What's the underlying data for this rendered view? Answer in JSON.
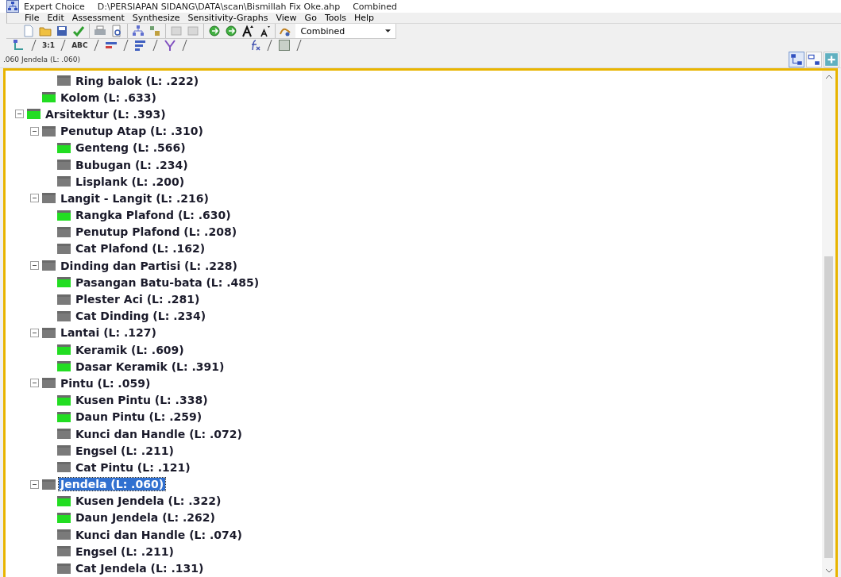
{
  "window": {
    "title": "Expert Choice",
    "file": "D:\\PERSIAPAN SIDANG\\DATA\\scan\\Bismillah Fix Oke.ahp",
    "mode": "Combined"
  },
  "menu": [
    "File",
    "Edit",
    "Assessment",
    "Synthesize",
    "Sensitivity-Graphs",
    "View",
    "Go",
    "Tools",
    "Help"
  ],
  "toolbar": {
    "combo": "Combined"
  },
  "view_tabs": [
    {
      "label": "3:1"
    },
    {
      "label": "ABC"
    }
  ],
  "status": ".060  Jendela (L: .060)",
  "tree": [
    {
      "children": [
        {
          "children": [
            {
              "label": "Ring balok (L: .222)",
              "color": "#7a7a7a",
              "selected": false
            }
          ]
        },
        {
          "label": "Kolom (L: .633)",
          "color": "#22dd22",
          "selected": false
        }
      ]
    },
    {
      "label": "Arsitektur (L: .393)",
      "color": "#22dd22",
      "selected": false,
      "expanded": true,
      "children": [
        {
          "label": "Penutup Atap (L: .310)",
          "color": "#7a7a7a",
          "selected": false,
          "expanded": true,
          "children": [
            {
              "label": "Genteng (L: .566)",
              "color": "#22dd22",
              "selected": false
            },
            {
              "label": "Bubugan (L: .234)",
              "color": "#7a7a7a",
              "selected": false
            },
            {
              "label": "Lisplank (L: .200)",
              "color": "#7a7a7a",
              "selected": false
            }
          ]
        },
        {
          "label": "Langit - Langit (L: .216)",
          "color": "#7a7a7a",
          "selected": false,
          "expanded": true,
          "children": [
            {
              "label": "Rangka Plafond (L: .630)",
              "color": "#22dd22",
              "selected": false
            },
            {
              "label": "Penutup Plafond (L: .208)",
              "color": "#7a7a7a",
              "selected": false
            },
            {
              "label": "Cat Plafond (L: .162)",
              "color": "#7a7a7a",
              "selected": false
            }
          ]
        },
        {
          "label": "Dinding dan Partisi (L: .228)",
          "color": "#7a7a7a",
          "selected": false,
          "expanded": true,
          "children": [
            {
              "label": "Pasangan Batu-bata (L: .485)",
              "color": "#22dd22",
              "selected": false
            },
            {
              "label": "Plester Aci (L: .281)",
              "color": "#7a7a7a",
              "selected": false
            },
            {
              "label": "Cat Dinding (L: .234)",
              "color": "#7a7a7a",
              "selected": false
            }
          ]
        },
        {
          "label": "Lantai (L: .127)",
          "color": "#7a7a7a",
          "selected": false,
          "expanded": true,
          "children": [
            {
              "label": "Keramik (L: .609)",
              "color": "#22dd22",
              "selected": false
            },
            {
              "label": "Dasar Keramik (L: .391)",
              "color": "#22dd22",
              "selected": false
            }
          ]
        },
        {
          "label": "Pintu (L: .059)",
          "color": "#7a7a7a",
          "selected": false,
          "expanded": true,
          "children": [
            {
              "label": "Kusen Pintu (L: .338)",
              "color": "#22dd22",
              "selected": false
            },
            {
              "label": "Daun Pintu (L: .259)",
              "color": "#22dd22",
              "selected": false
            },
            {
              "label": "Kunci dan Handle (L: .072)",
              "color": "#7a7a7a",
              "selected": false
            },
            {
              "label": "Engsel (L: .211)",
              "color": "#7a7a7a",
              "selected": false
            },
            {
              "label": "Cat Pintu (L: .121)",
              "color": "#7a7a7a",
              "selected": false
            }
          ]
        },
        {
          "label": "Jendela (L: .060)",
          "color": "#7a7a7a",
          "selected": true,
          "expanded": true,
          "children": [
            {
              "label": "Kusen Jendela (L: .322)",
              "color": "#22dd22",
              "selected": false
            },
            {
              "label": "Daun Jendela (L: .262)",
              "color": "#22dd22",
              "selected": false
            },
            {
              "label": "Kunci dan Handle (L: .074)",
              "color": "#7a7a7a",
              "selected": false
            },
            {
              "label": "Engsel (L: .211)",
              "color": "#7a7a7a",
              "selected": false
            },
            {
              "label": "Cat Jendela (L: .131)",
              "color": "#7a7a7a",
              "selected": false
            }
          ]
        }
      ]
    }
  ]
}
